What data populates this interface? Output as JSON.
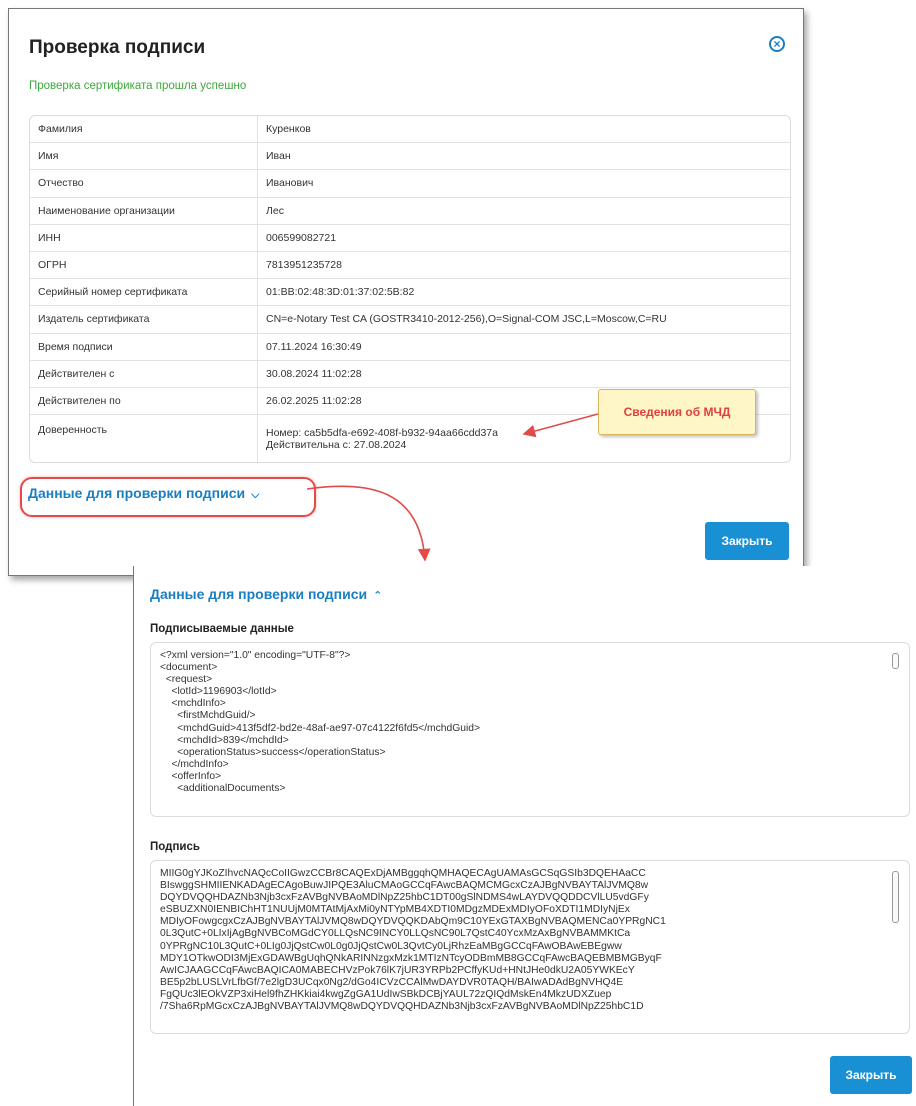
{
  "dialog": {
    "title": "Проверка подписи",
    "close_icon": "close-circle-icon",
    "success_message": "Проверка сертификата прошла успешно",
    "rows": [
      {
        "label": "Фамилия",
        "value": "Куренков"
      },
      {
        "label": "Имя",
        "value": "Иван"
      },
      {
        "label": "Отчество",
        "value": "Иванович"
      },
      {
        "label": "Наименование организации",
        "value": "Лес"
      },
      {
        "label": "ИНН",
        "value": "006599082721"
      },
      {
        "label": "ОГРН",
        "value": "7813951235728"
      },
      {
        "label": "Серийный номер сертификата",
        "value": "01:BB:02:48:3D:01:37:02:5B:82"
      },
      {
        "label": "Издатель сертификата",
        "value": "CN=e-Notary Test CA (GOSTR3410-2012-256),O=Signal-COM JSC,L=Moscow,C=RU"
      },
      {
        "label": "Время подписи",
        "value": "07.11.2024 16:30:49"
      },
      {
        "label": "Действителен с",
        "value": "30.08.2024 11:02:28"
      },
      {
        "label": "Действителен по",
        "value": "26.02.2025 11:02:28"
      }
    ],
    "poa": {
      "label": "Доверенность",
      "number": "Номер: ca5b5dfa-e692-408f-b932-94aa66cdd37a",
      "valid_from": "Действительна с: 27.08.2024"
    },
    "toggle_label": "Данные для проверки подписи",
    "toggle_icon_collapsed": "chevron-down-icon",
    "close_button": "Закрыть"
  },
  "callout": {
    "text": "Сведения об МЧД"
  },
  "panel": {
    "toggle_label": "Данные для проверки подписи",
    "toggle_icon_expanded": "chevron-up-icon",
    "signed_data_label": "Подписываемые данные",
    "signed_data_lines": [
      "<?xml version=\"1.0\" encoding=\"UTF-8\"?>",
      "<document>",
      "  <request>",
      "    <lotId>1196903</lotId>",
      "    <mchdInfo>",
      "      <firstMchdGuid/>",
      "      <mchdGuid>413f5df2-bd2e-48af-ae97-07c4122f6fd5</mchdGuid>",
      "      <mchdId>839</mchdId>",
      "      <operationStatus>success</operationStatus>",
      "    </mchdInfo>",
      "    <offerInfo>",
      "      <additionalDocuments>"
    ],
    "signature_label": "Подпись",
    "signature_lines": [
      "MIIG0gYJKoZIhvcNAQcCoIIGwzCCBr8CAQExDjAMBggqhQMHAQECAgUAMAsGCSqGSIb3DQEHAaCC",
      "BIswggSHMIIENKADAgECAgoBuwJIPQE3AluCMAoGCCqFAwcBAQMCMGcxCzAJBgNVBAYTAlJVMQ8w",
      "DQYDVQQHDAZNb3Njb3cxFzAVBgNVBAoMDlNpZ25hbC1DT00gSlNDMS4wLAYDVQQDDCVlLU5vdGFy",
      "eSBUZXN0IENBIChHT1NUUjM0MTAtMjAxMi0yNTYpMB4XDTI0MDgzMDExMDIyOFoXDTI1MDIyNjEx",
      "MDIyOFowgcgxCzAJBgNVBAYTAlJVMQ8wDQYDVQQKDAbQm9C10YExGTAXBgNVBAQMENCa0YPRgNC1",
      "0L3QutC+0LIxIjAgBgNVBCoMGdCY0LLQsNC9INCY0LLQsNC90L7QstC40YcxMzAxBgNVBAMMKtCa",
      "0YPRgNC10L3QutC+0LIg0JjQstCw0L0g0JjQstCw0L3QvtCy0LjRhzEaMBgGCCqFAwOBAwEBEgww",
      "MDY1OTkwODI3MjExGDAWBgUqhQNkARINNzgxMzk1MTIzNTcyODBmMB8GCCqFAwcBAQEBMBMGByqF",
      "AwICJAAGCCqFAwcBAQICA0MABECHVzPok76lK7jUR3YRPb2PCffyKUd+HNtJHe0dkU2A05YWKEcY",
      "BE5p2bLUSLVrLfbGf/7e2lgD3UCqx0Ng2/dGo4ICVzCCAlMwDAYDVR0TAQH/BAIwADAdBgNVHQ4E",
      "FgQUc3lEOkVZP3xiHel9fhZHKkiai4kwgZgGA1UdIwSBkDCBjYAUL72zQIQdMskEn4MkzUDXZuep",
      "/7Sha6RpMGcxCzAJBgNVBAYTAlJVMQ8wDQYDVQQHDAZNb3Njb3cxFzAVBgNVBAoMDlNpZ25hbC1D"
    ],
    "close_button": "Закрыть"
  }
}
